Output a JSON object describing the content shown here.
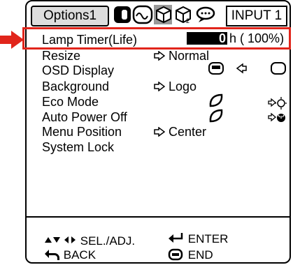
{
  "header": {
    "active_tab": "Options1",
    "input": "INPUT 1",
    "icons": [
      "picture-icon",
      "audio-icon",
      "options1-icon",
      "options2-icon",
      "language-icon"
    ]
  },
  "menu": {
    "lamp_timer": {
      "label": "Lamp Timer(Life)",
      "hours": "0",
      "unit": "h",
      "percent": "( 100%)"
    },
    "resize": {
      "label": "Resize",
      "value": "Normal"
    },
    "osd_display": {
      "label": "OSD Display"
    },
    "background": {
      "label": "Background",
      "value": "Logo"
    },
    "eco_mode": {
      "label": "Eco Mode"
    },
    "auto_power_off": {
      "label": "Auto Power Off"
    },
    "menu_position": {
      "label": "Menu Position",
      "value": "Center"
    },
    "system_lock": {
      "label": "System Lock"
    }
  },
  "footer": {
    "sel_adj": "SEL./ADJ.",
    "enter": "ENTER",
    "back": "BACK",
    "end": "END"
  },
  "colors": {
    "highlight": "#e1251b"
  }
}
